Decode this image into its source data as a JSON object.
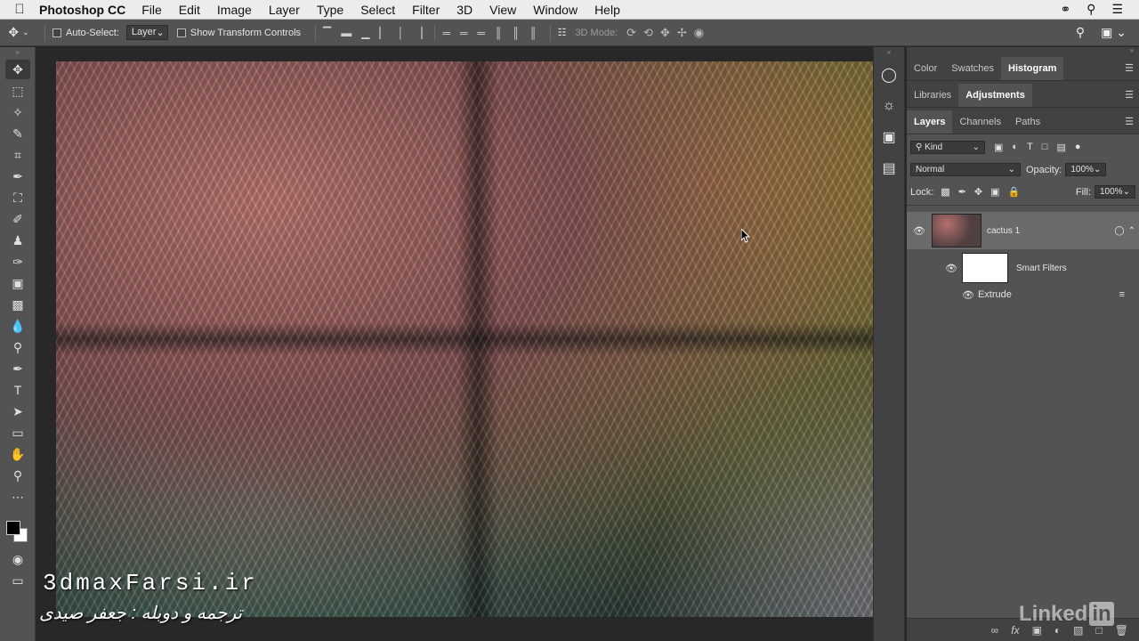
{
  "menubar": {
    "app_name": "Photoshop CC",
    "items": [
      "File",
      "Edit",
      "Image",
      "Layer",
      "Type",
      "Select",
      "Filter",
      "3D",
      "View",
      "Window",
      "Help"
    ]
  },
  "options_bar": {
    "auto_select_label": "Auto-Select:",
    "auto_select_value": "Layer",
    "show_transform_label": "Show Transform Controls",
    "mode_3d_label": "3D Mode:"
  },
  "panels": {
    "top_tabs": [
      "Color",
      "Swatches",
      "Histogram"
    ],
    "top_active": "Histogram",
    "mid_tabs": [
      "Libraries",
      "Adjustments"
    ],
    "mid_active": "Adjustments",
    "layer_tabs": [
      "Layers",
      "Channels",
      "Paths"
    ],
    "layer_active": "Layers",
    "filter_kind": "Kind",
    "blend_mode": "Normal",
    "opacity_label": "Opacity:",
    "opacity_value": "100%",
    "lock_label": "Lock:",
    "fill_label": "Fill:",
    "fill_value": "100%",
    "layer_name": "cactus 1",
    "smart_filters_label": "Smart Filters",
    "filter_name": "Extrude"
  },
  "watermark": {
    "site": "3dmaxFarsi.ir",
    "credit": "ترجمه و دوبله : جعفر صیدی"
  },
  "brand": {
    "linkedin_word": "Linked",
    "linkedin_in": "in"
  },
  "colors": {
    "foreground": "#000000",
    "background": "#ffffff"
  }
}
